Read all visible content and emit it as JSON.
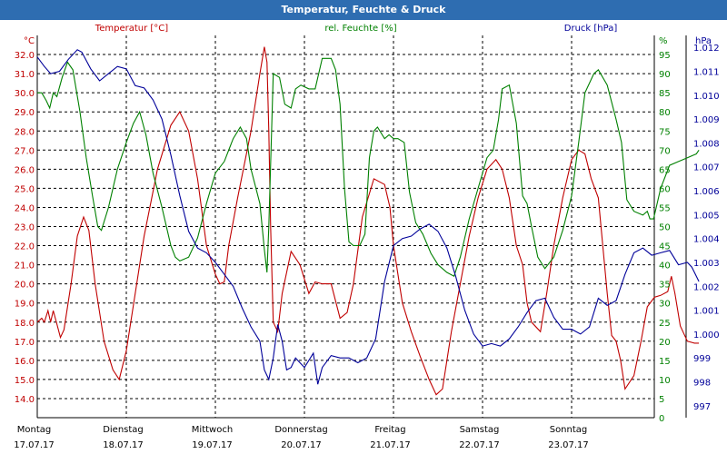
{
  "window": {
    "title": "Temperatur, Feuchte & Druck"
  },
  "colors": {
    "temperature": "#c00000",
    "humidity": "#008000",
    "pressure": "#000099",
    "titlebar": "#2e6db1"
  },
  "chart_data": {
    "type": "line",
    "title": "Temperatur, Feuchte & Druck",
    "x_labels": [
      {
        "day": "Montag",
        "date": "17.07.17"
      },
      {
        "day": "Dienstag",
        "date": "18.07.17"
      },
      {
        "day": "Mittwoch",
        "date": "19.07.17"
      },
      {
        "day": "Donnerstag",
        "date": "20.07.17"
      },
      {
        "day": "Freitag",
        "date": "21.07.17"
      },
      {
        "day": "Samstag",
        "date": "22.07.17"
      },
      {
        "day": "Sonntag",
        "date": "23.07.17"
      }
    ],
    "xlim": [
      0,
      7
    ],
    "grid": true,
    "axes": {
      "temperature": {
        "label": "Temperatur [°C]",
        "unit": "°C",
        "ylim": [
          13,
          33
        ],
        "ticks": [
          "14.0",
          "15.0",
          "16.0",
          "17.0",
          "18.0",
          "19.0",
          "20.0",
          "21.0",
          "22.0",
          "23.0",
          "24.0",
          "25.0",
          "26.0",
          "27.0",
          "28.0",
          "29.0",
          "30.0",
          "31.0",
          "32.0"
        ]
      },
      "humidity": {
        "label": "rel. Feuchte [%]",
        "unit": "%",
        "ylim": [
          0,
          100
        ],
        "ticks": [
          "0",
          "5",
          "10",
          "15",
          "20",
          "25",
          "30",
          "35",
          "40",
          "45",
          "50",
          "55",
          "60",
          "65",
          "70",
          "75",
          "80",
          "85",
          "90",
          "95"
        ]
      },
      "pressure": {
        "label": "Druck [hPa]",
        "unit": "hPa",
        "ylim": [
          996.5,
          1012.5
        ],
        "ticks": [
          "997",
          "998",
          "999",
          "1.000",
          "1.001",
          "1.002",
          "1.003",
          "1.004",
          "1.005",
          "1.006",
          "1.007",
          "1.008",
          "1.009",
          "1.010",
          "1.011",
          "1.012"
        ]
      }
    },
    "series": [
      {
        "name": "Temperatur [°C]",
        "axis": "temperature",
        "points": [
          [
            0,
            18.0
          ],
          [
            0.05,
            18.2
          ],
          [
            0.08,
            18.0
          ],
          [
            0.12,
            18.6
          ],
          [
            0.15,
            18.0
          ],
          [
            0.18,
            18.6
          ],
          [
            0.22,
            17.9
          ],
          [
            0.26,
            17.2
          ],
          [
            0.3,
            17.6
          ],
          [
            0.38,
            20.0
          ],
          [
            0.45,
            22.5
          ],
          [
            0.52,
            23.5
          ],
          [
            0.58,
            22.8
          ],
          [
            0.65,
            20.0
          ],
          [
            0.75,
            17.0
          ],
          [
            0.85,
            15.5
          ],
          [
            0.92,
            15.0
          ],
          [
            1.0,
            16.5
          ],
          [
            1.1,
            19.5
          ],
          [
            1.2,
            22.5
          ],
          [
            1.35,
            26.0
          ],
          [
            1.5,
            28.3
          ],
          [
            1.6,
            29.0
          ],
          [
            1.7,
            28.0
          ],
          [
            1.8,
            25.5
          ],
          [
            1.9,
            22.0
          ],
          [
            2.0,
            20.5
          ],
          [
            2.05,
            20.0
          ],
          [
            2.1,
            20.1
          ],
          [
            2.15,
            22.0
          ],
          [
            2.25,
            24.5
          ],
          [
            2.4,
            28.0
          ],
          [
            2.5,
            31.0
          ],
          [
            2.55,
            32.4
          ],
          [
            2.58,
            31.6
          ],
          [
            2.6,
            28.0
          ],
          [
            2.62,
            23.0
          ],
          [
            2.65,
            18.0
          ],
          [
            2.7,
            17.5
          ],
          [
            2.75,
            19.5
          ],
          [
            2.85,
            21.7
          ],
          [
            2.95,
            21.0
          ],
          [
            3.05,
            19.5
          ],
          [
            3.12,
            20.1
          ],
          [
            3.2,
            20.0
          ],
          [
            3.3,
            20.0
          ],
          [
            3.4,
            18.2
          ],
          [
            3.48,
            18.5
          ],
          [
            3.55,
            20.0
          ],
          [
            3.65,
            23.5
          ],
          [
            3.78,
            25.5
          ],
          [
            3.9,
            25.2
          ],
          [
            3.96,
            24.0
          ],
          [
            4.0,
            22.0
          ],
          [
            4.1,
            19.0
          ],
          [
            4.2,
            17.5
          ],
          [
            4.3,
            16.2
          ],
          [
            4.4,
            15.0
          ],
          [
            4.48,
            14.2
          ],
          [
            4.55,
            14.5
          ],
          [
            4.65,
            17.5
          ],
          [
            4.75,
            20.0
          ],
          [
            4.85,
            22.5
          ],
          [
            4.95,
            24.5
          ],
          [
            5.05,
            26.0
          ],
          [
            5.15,
            26.5
          ],
          [
            5.22,
            26.0
          ],
          [
            5.3,
            24.5
          ],
          [
            5.38,
            22.0
          ],
          [
            5.45,
            21.0
          ],
          [
            5.5,
            19.0
          ],
          [
            5.55,
            18.0
          ],
          [
            5.65,
            17.5
          ],
          [
            5.72,
            19.5
          ],
          [
            5.8,
            22.0
          ],
          [
            5.9,
            24.5
          ],
          [
            6.0,
            26.5
          ],
          [
            6.08,
            27.0
          ],
          [
            6.15,
            26.8
          ],
          [
            6.22,
            25.5
          ],
          [
            6.3,
            24.5
          ],
          [
            6.35,
            22.0
          ],
          [
            6.4,
            19.5
          ],
          [
            6.45,
            17.3
          ],
          [
            6.5,
            17.0
          ],
          [
            6.55,
            16.0
          ],
          [
            6.6,
            14.5
          ],
          [
            6.7,
            15.2
          ],
          [
            6.78,
            17.0
          ],
          [
            6.85,
            18.8
          ],
          [
            6.93,
            19.3
          ],
          [
            7.0,
            19.4
          ],
          [
            7.08,
            19.6
          ],
          [
            7.12,
            20.4
          ],
          [
            7.16,
            19.5
          ],
          [
            7.22,
            17.8
          ],
          [
            7.3,
            17.0
          ],
          [
            7.38,
            16.9
          ],
          [
            7.43,
            16.9
          ]
        ]
      },
      {
        "name": "rel. Feuchte [%]",
        "axis": "humidity",
        "points": [
          [
            0,
            85
          ],
          [
            0.05,
            85
          ],
          [
            0.1,
            83
          ],
          [
            0.14,
            81
          ],
          [
            0.18,
            85
          ],
          [
            0.22,
            84
          ],
          [
            0.28,
            89
          ],
          [
            0.34,
            93
          ],
          [
            0.4,
            91
          ],
          [
            0.48,
            80
          ],
          [
            0.55,
            68
          ],
          [
            0.62,
            58
          ],
          [
            0.68,
            50
          ],
          [
            0.72,
            49
          ],
          [
            0.8,
            55
          ],
          [
            0.9,
            65
          ],
          [
            1.0,
            72
          ],
          [
            1.08,
            77
          ],
          [
            1.15,
            80
          ],
          [
            1.22,
            74
          ],
          [
            1.3,
            64
          ],
          [
            1.4,
            55
          ],
          [
            1.5,
            45
          ],
          [
            1.55,
            42
          ],
          [
            1.6,
            41
          ],
          [
            1.7,
            42
          ],
          [
            1.8,
            47
          ],
          [
            1.9,
            56
          ],
          [
            2.0,
            64
          ],
          [
            2.1,
            67
          ],
          [
            2.2,
            73
          ],
          [
            2.28,
            76
          ],
          [
            2.35,
            73
          ],
          [
            2.4,
            65
          ],
          [
            2.5,
            56
          ],
          [
            2.55,
            44
          ],
          [
            2.58,
            38
          ],
          [
            2.6,
            50
          ],
          [
            2.65,
            90
          ],
          [
            2.72,
            89
          ],
          [
            2.78,
            82
          ],
          [
            2.85,
            81
          ],
          [
            2.9,
            86
          ],
          [
            2.96,
            87
          ],
          [
            3.05,
            86
          ],
          [
            3.12,
            86
          ],
          [
            3.2,
            94
          ],
          [
            3.3,
            94
          ],
          [
            3.35,
            91
          ],
          [
            3.4,
            82
          ],
          [
            3.45,
            60
          ],
          [
            3.5,
            46
          ],
          [
            3.55,
            45
          ],
          [
            3.62,
            45
          ],
          [
            3.68,
            48
          ],
          [
            3.73,
            68
          ],
          [
            3.78,
            75
          ],
          [
            3.82,
            76
          ],
          [
            3.9,
            73
          ],
          [
            3.95,
            74
          ],
          [
            4.0,
            73
          ],
          [
            4.05,
            73
          ],
          [
            4.12,
            72
          ],
          [
            4.18,
            59
          ],
          [
            4.25,
            51
          ],
          [
            4.33,
            48
          ],
          [
            4.42,
            43
          ],
          [
            4.5,
            40
          ],
          [
            4.6,
            38
          ],
          [
            4.68,
            37
          ],
          [
            4.75,
            42
          ],
          [
            4.85,
            52
          ],
          [
            4.95,
            60
          ],
          [
            5.05,
            68
          ],
          [
            5.12,
            70
          ],
          [
            5.18,
            78
          ],
          [
            5.22,
            86
          ],
          [
            5.3,
            87
          ],
          [
            5.38,
            77
          ],
          [
            5.45,
            58
          ],
          [
            5.5,
            56
          ],
          [
            5.55,
            50
          ],
          [
            5.62,
            42
          ],
          [
            5.7,
            39
          ],
          [
            5.8,
            42
          ],
          [
            5.9,
            49
          ],
          [
            6.0,
            58
          ],
          [
            6.08,
            72
          ],
          [
            6.15,
            85
          ],
          [
            6.25,
            90
          ],
          [
            6.3,
            91
          ],
          [
            6.4,
            87
          ],
          [
            6.5,
            78
          ],
          [
            6.56,
            72
          ],
          [
            6.62,
            57
          ],
          [
            6.7,
            54
          ],
          [
            6.8,
            53
          ],
          [
            6.85,
            54
          ],
          [
            6.88,
            52
          ],
          [
            6.92,
            52
          ],
          [
            7.0,
            60
          ],
          [
            7.1,
            66
          ],
          [
            7.2,
            67
          ],
          [
            7.3,
            68
          ],
          [
            7.4,
            69
          ],
          [
            7.43,
            70
          ]
        ]
      },
      {
        "name": "Druck [hPa]",
        "axis": "pressure",
        "points": [
          [
            0,
            1011.6
          ],
          [
            0.08,
            1011.2
          ],
          [
            0.15,
            1010.9
          ],
          [
            0.25,
            1011.0
          ],
          [
            0.35,
            1011.5
          ],
          [
            0.45,
            1011.9
          ],
          [
            0.5,
            1011.8
          ],
          [
            0.6,
            1011.1
          ],
          [
            0.7,
            1010.6
          ],
          [
            0.8,
            1010.9
          ],
          [
            0.9,
            1011.2
          ],
          [
            1.0,
            1011.1
          ],
          [
            1.1,
            1010.4
          ],
          [
            1.2,
            1010.3
          ],
          [
            1.3,
            1009.8
          ],
          [
            1.4,
            1009.0
          ],
          [
            1.5,
            1007.5
          ],
          [
            1.6,
            1005.8
          ],
          [
            1.7,
            1004.3
          ],
          [
            1.8,
            1003.6
          ],
          [
            1.9,
            1003.4
          ],
          [
            2.0,
            1003.0
          ],
          [
            2.1,
            1002.5
          ],
          [
            2.2,
            1002.0
          ],
          [
            2.3,
            1001.1
          ],
          [
            2.4,
            1000.3
          ],
          [
            2.5,
            999.7
          ],
          [
            2.55,
            998.5
          ],
          [
            2.6,
            998.1
          ],
          [
            2.65,
            999.0
          ],
          [
            2.7,
            1000.4
          ],
          [
            2.75,
            999.7
          ],
          [
            2.8,
            998.5
          ],
          [
            2.85,
            998.6
          ],
          [
            2.9,
            999.0
          ],
          [
            3.0,
            998.6
          ],
          [
            3.1,
            999.2
          ],
          [
            3.15,
            997.9
          ],
          [
            3.2,
            998.6
          ],
          [
            3.3,
            999.1
          ],
          [
            3.4,
            999.0
          ],
          [
            3.5,
            999.0
          ],
          [
            3.6,
            998.8
          ],
          [
            3.7,
            999.0
          ],
          [
            3.8,
            999.8
          ],
          [
            3.9,
            1002.2
          ],
          [
            4.0,
            1003.7
          ],
          [
            4.1,
            1004.0
          ],
          [
            4.2,
            1004.1
          ],
          [
            4.3,
            1004.4
          ],
          [
            4.4,
            1004.6
          ],
          [
            4.5,
            1004.3
          ],
          [
            4.6,
            1003.6
          ],
          [
            4.7,
            1002.4
          ],
          [
            4.8,
            1001.0
          ],
          [
            4.9,
            1000.0
          ],
          [
            5.0,
            999.5
          ],
          [
            5.1,
            999.6
          ],
          [
            5.2,
            999.5
          ],
          [
            5.3,
            999.8
          ],
          [
            5.4,
            1000.3
          ],
          [
            5.5,
            1000.9
          ],
          [
            5.6,
            1001.4
          ],
          [
            5.7,
            1001.5
          ],
          [
            5.8,
            1000.7
          ],
          [
            5.9,
            1000.2
          ],
          [
            6.0,
            1000.2
          ],
          [
            6.1,
            1000.0
          ],
          [
            6.2,
            1000.3
          ],
          [
            6.3,
            1001.5
          ],
          [
            6.4,
            1001.2
          ],
          [
            6.5,
            1001.4
          ],
          [
            6.6,
            1002.5
          ],
          [
            6.7,
            1003.4
          ],
          [
            6.8,
            1003.6
          ],
          [
            6.9,
            1003.3
          ],
          [
            7.0,
            1003.4
          ],
          [
            7.1,
            1003.5
          ],
          [
            7.2,
            1002.9
          ],
          [
            7.3,
            1003.0
          ],
          [
            7.35,
            1002.8
          ],
          [
            7.43,
            1002.2
          ]
        ]
      }
    ]
  }
}
